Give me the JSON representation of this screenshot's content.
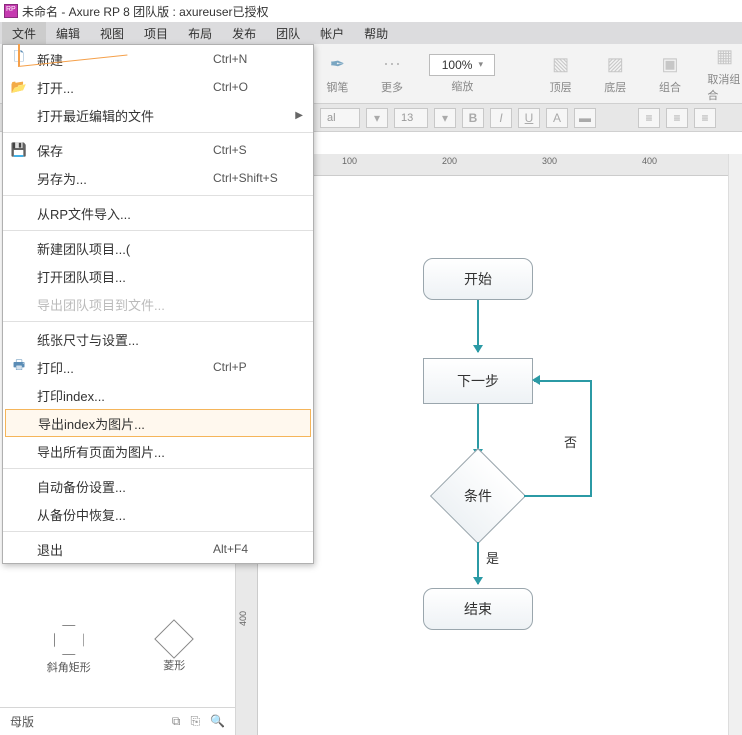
{
  "title": "未命名 - Axure RP 8 团队版 : axureuser已授权",
  "menubar": [
    "文件",
    "编辑",
    "视图",
    "项目",
    "布局",
    "发布",
    "团队",
    "帐户",
    "帮助"
  ],
  "toolbar": {
    "pen": "钢笔",
    "more": "更多",
    "zoom_value": "100%",
    "zoom_label": "缩放",
    "front": "顶层",
    "back": "底层",
    "group": "组合",
    "ungroup": "取消组合"
  },
  "toolbar2": {
    "font_suffix": "al",
    "font_size": "13"
  },
  "file_menu": {
    "new": "新建",
    "new_sc": "Ctrl+N",
    "open": "打开...",
    "open_sc": "Ctrl+O",
    "recent": "打开最近编辑的文件",
    "save": "保存",
    "save_sc": "Ctrl+S",
    "saveas": "另存为...",
    "saveas_sc": "Ctrl+Shift+S",
    "import_rp": "从RP文件导入...",
    "new_team": "新建团队项目...(",
    "open_team": "打开团队项目...",
    "export_team": "导出团队项目到文件...",
    "page_setup": "纸张尺寸与设置...",
    "print": "打印...",
    "print_sc": "Ctrl+P",
    "print_index": "打印index...",
    "export_index_img": "导出index为图片...",
    "export_all_img": "导出所有页面为图片...",
    "auto_backup": "自动备份设置...",
    "restore_backup": "从备份中恢复...",
    "exit": "退出",
    "exit_sc": "Alt+F4"
  },
  "shapes": {
    "octagon": "斜角矩形",
    "diamond": "菱形"
  },
  "bottom": {
    "master": "母版"
  },
  "ruler_h": [
    "100",
    "200",
    "300",
    "400"
  ],
  "ruler_v": [
    "400"
  ],
  "flow": {
    "start": "开始",
    "next": "下一步",
    "cond": "条件",
    "end": "结束",
    "no": "否",
    "yes": "是"
  }
}
